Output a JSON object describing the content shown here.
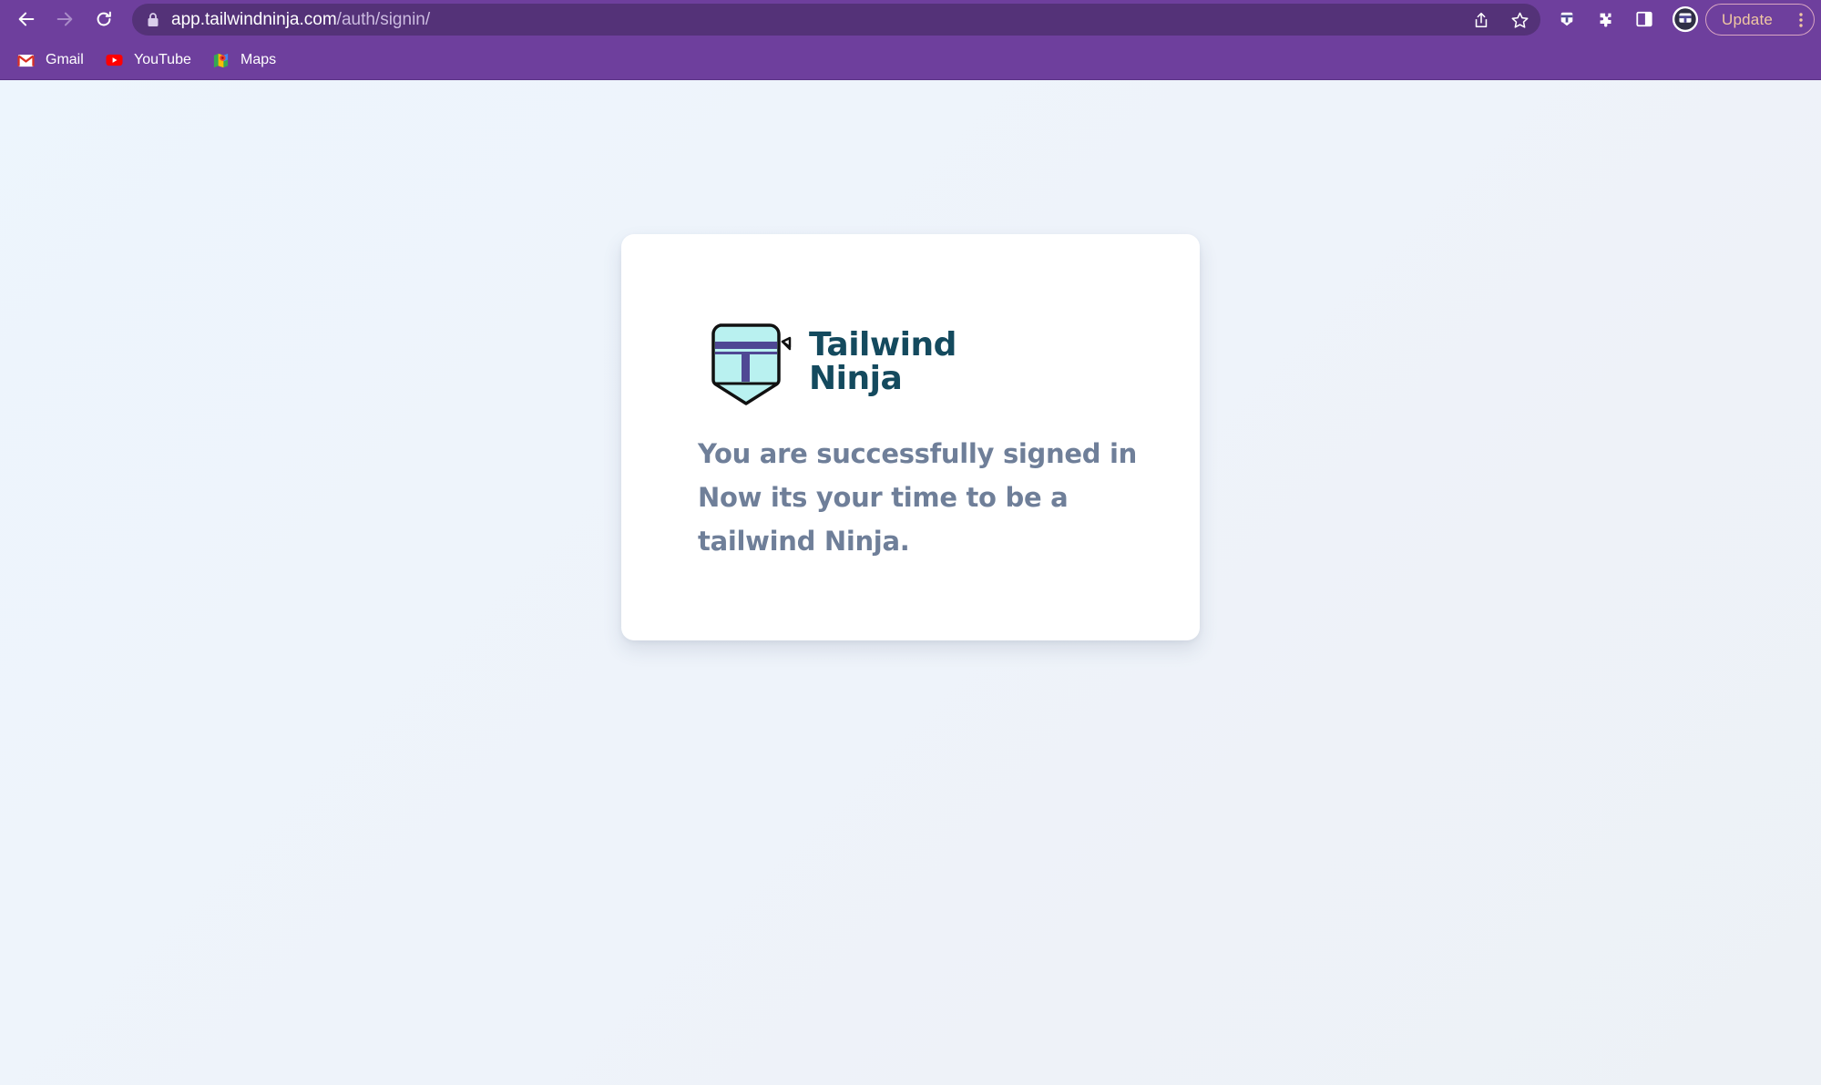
{
  "browser": {
    "url_host": "app.tailwindninja.com",
    "url_path": "/auth/signin/",
    "update_label": "Update",
    "bookmarks": [
      {
        "label": "Gmail",
        "icon": "gmail-icon"
      },
      {
        "label": "YouTube",
        "icon": "youtube-icon"
      },
      {
        "label": "Maps",
        "icon": "maps-icon"
      }
    ],
    "colors": {
      "toolbar": "#6e3f9d",
      "omnibox": "#543278",
      "update_text": "#f1c8a2"
    }
  },
  "page": {
    "brand_line1": "Tailwind",
    "brand_line2": "Ninja",
    "message_lines": [
      "You are successfully signed in",
      "Now its your time to be a",
      "tailwind Ninja."
    ],
    "colors": {
      "brand_text": "#144a5e",
      "message_text": "#6f7f99",
      "logo_fill": "#b9f1f0",
      "logo_band": "#4f4894"
    }
  }
}
